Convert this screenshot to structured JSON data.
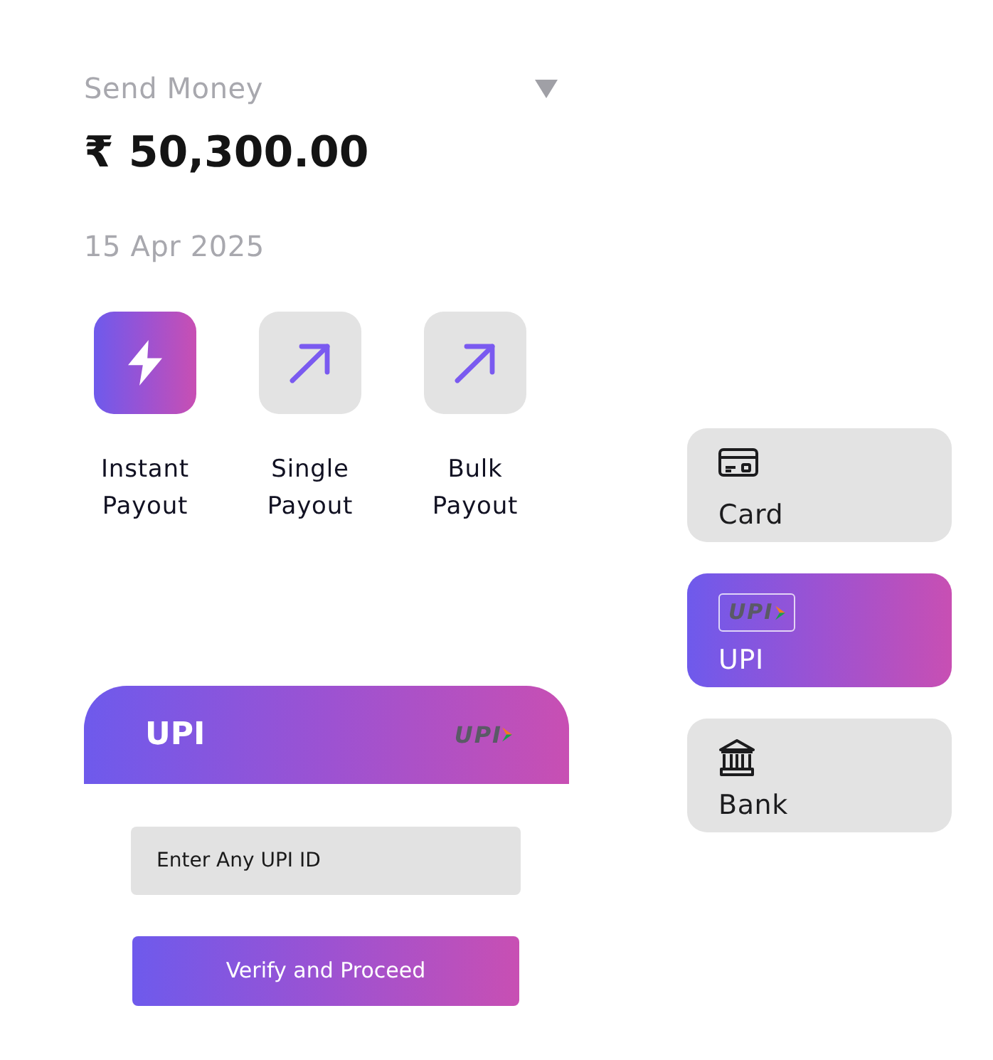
{
  "header": {
    "title": "Send Money",
    "amount": "₹ 50,300.00",
    "date": "15 Apr 2025"
  },
  "payout_options": [
    {
      "label": "Instant Payout",
      "kind": "instant",
      "selected": true
    },
    {
      "label": "Single Payout",
      "kind": "single",
      "selected": false
    },
    {
      "label": "Bulk Payout",
      "kind": "bulk",
      "selected": false
    }
  ],
  "payment_methods": [
    {
      "label": "Card",
      "kind": "card",
      "selected": false
    },
    {
      "label": "UPI",
      "kind": "upi",
      "logo_text": "UPI",
      "selected": true
    },
    {
      "label": "Bank",
      "kind": "bank",
      "selected": false
    }
  ],
  "upi_panel": {
    "title": "UPI",
    "logo_text": "UPI",
    "upi_field": {
      "placeholder": "Enter Any UPI ID"
    },
    "submit_button": "Verify and Proceed"
  }
}
